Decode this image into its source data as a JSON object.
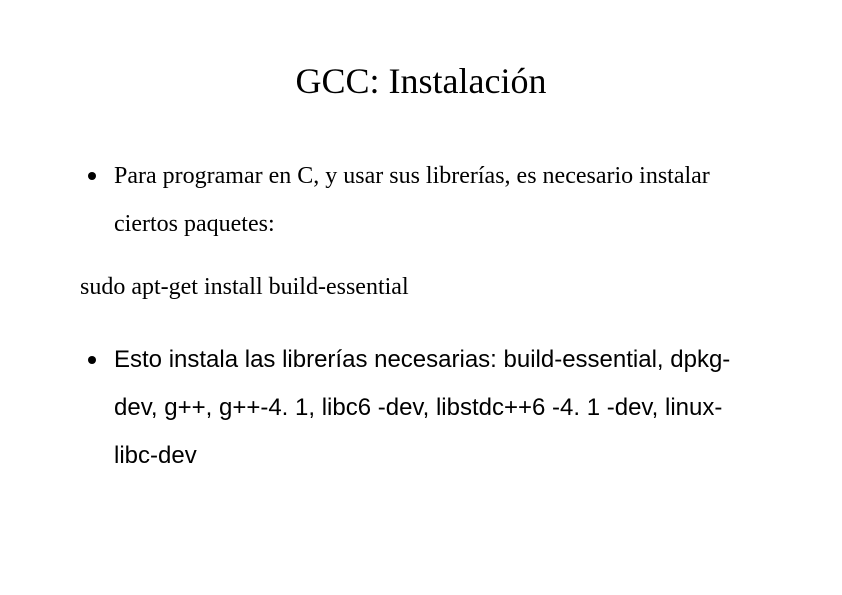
{
  "title": "GCC: Instalación",
  "bullets": [
    {
      "text": "Para programar en C, y usar sus librerías, es necesario instalar ciertos paquetes:",
      "fontClass": "serif"
    },
    {
      "text": "Esto instala las librerías necesarias: build-essential, dpkg-dev, g++,  g++-4. 1, libc6 -dev, libstdc++6 -4. 1 -dev, linux-libc-dev",
      "fontClass": "sans"
    }
  ],
  "command": "sudo apt-get install build-essential"
}
